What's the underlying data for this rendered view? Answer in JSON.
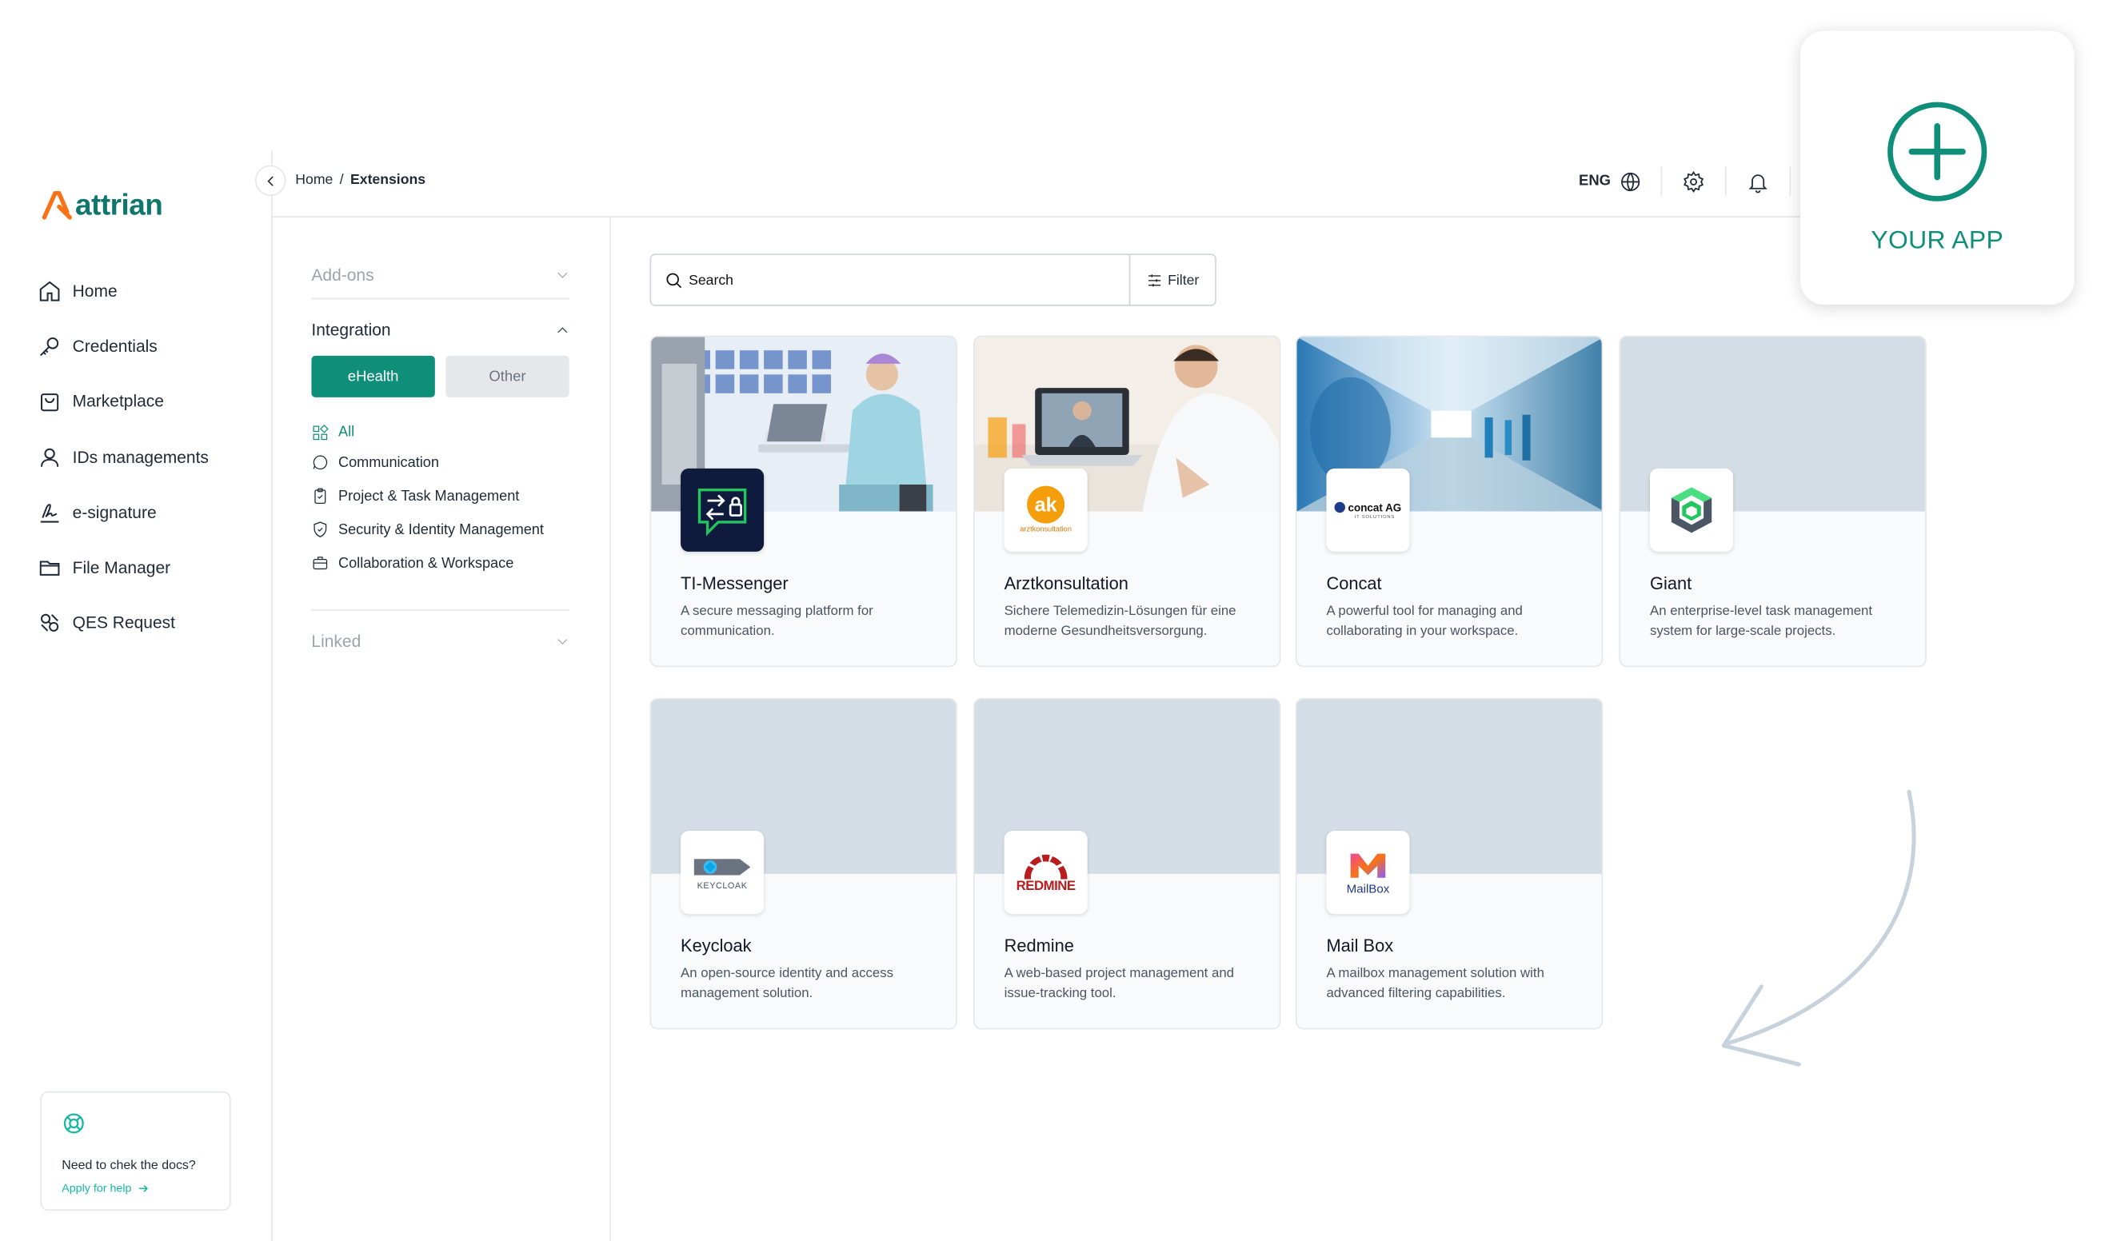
{
  "app": {
    "logo_text": "attrian",
    "brand_color": "#0f8f7a"
  },
  "sidebar": {
    "items": [
      {
        "label": "Home",
        "icon": "home-icon"
      },
      {
        "label": "Credentials",
        "icon": "key-icon"
      },
      {
        "label": "Marketplace",
        "icon": "shopping-bag-icon"
      },
      {
        "label": "IDs managements",
        "icon": "user-icon"
      },
      {
        "label": "e-signature",
        "icon": "signature-icon"
      },
      {
        "label": "File Manager",
        "icon": "folder-icon"
      },
      {
        "label": "QES Request",
        "icon": "qes-icon"
      }
    ],
    "help": {
      "title": "Need to chek the docs?",
      "link": "Apply for help"
    }
  },
  "header": {
    "breadcrumb": {
      "home": "Home",
      "separator": "/",
      "current": "Extensions"
    },
    "language": "ENG"
  },
  "filters": {
    "addons": "Add-ons",
    "integration": "Integration",
    "segments": {
      "ehealth": "eHealth",
      "other": "Other"
    },
    "categories": [
      "All",
      "Communication",
      "Project & Task Management",
      "Security & Identity Management",
      "Collaboration & Workspace"
    ],
    "linked": "Linked"
  },
  "search": {
    "placeholder": "Search",
    "filter_label": "Filter"
  },
  "extensions": [
    {
      "title": "TI-Messenger",
      "desc": "A secure messaging platform for communication."
    },
    {
      "title": "Arztkonsultation",
      "desc": "Sichere Telemedizin-Lösungen für eine moderne Gesundheitsversorgung.",
      "logo_text": "ak",
      "logo_sub": "arztkonsultation"
    },
    {
      "title": "Concat",
      "desc": "A powerful tool for managing and collaborating in your workspace.",
      "logo_text": "concat AG",
      "logo_sub": "IT SOLUTIONS"
    },
    {
      "title": "Giant",
      "desc": "An enterprise-level task management system for large-scale projects."
    },
    {
      "title": "Keycloak",
      "desc": "An open-source identity and access management solution.",
      "logo_text": "KEYCLOAK"
    },
    {
      "title": "Redmine",
      "desc": "A web-based project management and issue-tracking tool.",
      "logo_text": "REDMINE"
    },
    {
      "title": "Mail Box",
      "desc": "A mailbox management solution with advanced filtering capabilities.",
      "logo_text": "MailBox"
    }
  ],
  "your_app": {
    "label": "YOUR APP"
  }
}
